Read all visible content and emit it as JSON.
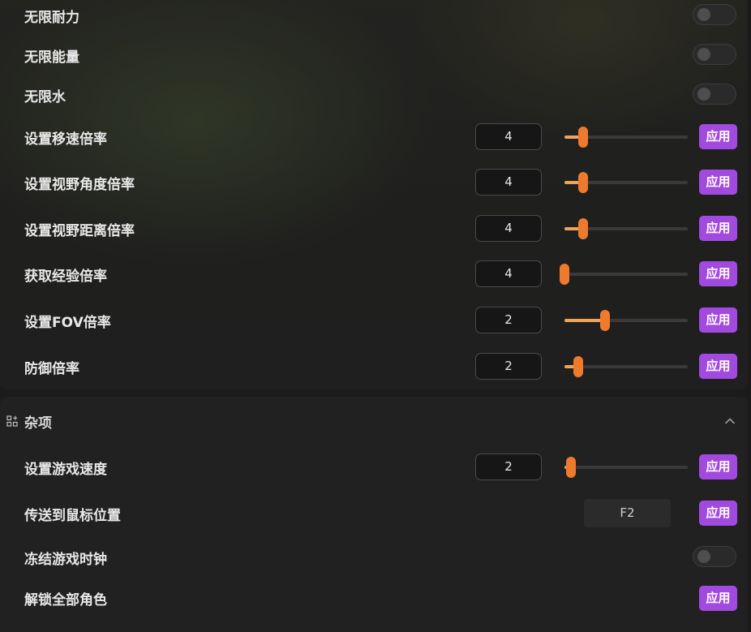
{
  "section_top": {
    "toggles": [
      {
        "label": "无限耐力",
        "on": false
      },
      {
        "label": "无限能量",
        "on": false
      },
      {
        "label": "无限水",
        "on": false
      }
    ],
    "sliders": [
      {
        "label": "设置移速倍率",
        "value": "4",
        "level": 0.15,
        "apply": "应用"
      },
      {
        "label": "设置视野角度倍率",
        "value": "4",
        "level": 0.15,
        "apply": "应用"
      },
      {
        "label": "设置视野距离倍率",
        "value": "4",
        "level": 0.15,
        "apply": "应用"
      },
      {
        "label": "获取经验倍率",
        "value": "4",
        "level": 0.0,
        "apply": "应用"
      },
      {
        "label": "设置FOV倍率",
        "value": "2",
        "level": 0.33,
        "apply": "应用"
      },
      {
        "label": "防御倍率",
        "value": "2",
        "level": 0.11,
        "apply": "应用"
      }
    ]
  },
  "section_misc": {
    "title": "杂项",
    "icon": "grid-add-icon",
    "collapse_icon": "chevron-up-icon",
    "game_speed": {
      "label": "设置游戏速度",
      "value": "2",
      "level": 0.05,
      "apply": "应用"
    },
    "teleport": {
      "label": "传送到鼠标位置",
      "hotkey": "F2",
      "apply": "应用"
    },
    "freeze_clock": {
      "label": "冻结游戏时钟",
      "on": false
    },
    "unlock_chars": {
      "label": "解锁全部角色",
      "apply": "应用"
    }
  },
  "colors": {
    "accent_button": "#a24ae0",
    "slider_thumb": "#ee7a2e",
    "slider_fill": "#f0a35a"
  }
}
